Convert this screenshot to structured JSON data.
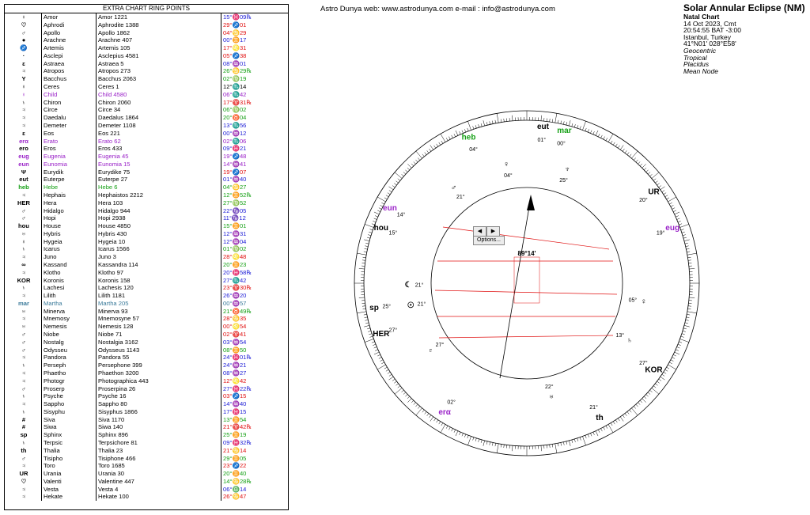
{
  "site_header": "Astro Dunya web: www.astrodunya.com e-mail : info@astrodunya.com",
  "chart_info": {
    "title": "Solar Annular Eclipse (NM)",
    "chart_type": "Natal Chart",
    "date": "14 Oct 2023, Cmt",
    "time": "20:54:55  BAT -3:00",
    "place": "Istanbul, Turkey",
    "coords": "41°N01' 028°E58'",
    "settings": [
      "Geocentric",
      "Tropical",
      "Placidus",
      "Mean Node"
    ]
  },
  "table": {
    "title": "EXTRA CHART RING POINTS",
    "rows": [
      {
        "glyph": "♀",
        "name": "Amor",
        "full": "Amor 1221",
        "pos": "15°♓09℞",
        "color": "#1c1cd6"
      },
      {
        "glyph": "♡",
        "name": "Aphrodi",
        "full": "Aphrodite 1388",
        "pos": "29°♐01",
        "color": "#e01010"
      },
      {
        "glyph": "♂",
        "name": "Apollo",
        "full": "Apollo 1862",
        "pos": "04°♋29",
        "color": "#e01010"
      },
      {
        "glyph": "●",
        "name": "Arachne",
        "full": "Arachne 407",
        "pos": "00°♊17",
        "color": "#1c1cd6"
      },
      {
        "glyph": "♐",
        "name": "Artemis",
        "full": "Artemis 105",
        "pos": "17°♌31",
        "color": "#e01010"
      },
      {
        "glyph": "·",
        "name": "Asclepi",
        "full": "Asclepius 4581",
        "pos": "05°♐38",
        "color": "#e01010"
      },
      {
        "glyph": "ɛ",
        "name": "Astraea",
        "full": "Astraea 5",
        "pos": "08°♒01",
        "color": "#1c1cd6"
      },
      {
        "glyph": "♃",
        "name": "Atropos",
        "full": "Atropos 273",
        "pos": "26°♋29℞",
        "color": "#16a016"
      },
      {
        "glyph": "Y",
        "name": "Bacchus",
        "full": "Bacchus 2063",
        "pos": "02°♍19",
        "color": "#16a016"
      },
      {
        "glyph": "♀",
        "name": "Ceres",
        "full": "Ceres 1",
        "pos": "12°♏14",
        "color": "#000000"
      },
      {
        "glyph": "♀",
        "name": "Child",
        "full": "Child 4580",
        "pos": "06°♏42",
        "color": "#9a22c8",
        "hl": true
      },
      {
        "glyph": "♄",
        "name": "Chiron",
        "full": "Chiron 2060",
        "pos": "17°♈31℞",
        "color": "#e01010"
      },
      {
        "glyph": "♃",
        "name": "Circe",
        "full": "Circe 34",
        "pos": "06°♍02",
        "color": "#16a016"
      },
      {
        "glyph": "♃",
        "name": "Daedalu",
        "full": "Daedalus 1864",
        "pos": "20°♉04",
        "color": "#16a016"
      },
      {
        "glyph": "♃",
        "name": "Demeter",
        "full": "Demeter 1108",
        "pos": "13°♏56",
        "color": "#1c1cd6"
      },
      {
        "glyph": "ɛ",
        "name": "Eos",
        "full": "Eos 221",
        "pos": "00°♒12",
        "color": "#1c1cd6"
      },
      {
        "glyph": "erα",
        "name": "Erato",
        "full": "Erato 62",
        "pos": "02°♏06",
        "color": "#9a22c8",
        "hl": true
      },
      {
        "glyph": "ero",
        "name": "Eros",
        "full": "Eros 433",
        "pos": "09°♓21",
        "color": "#1c1cd6"
      },
      {
        "glyph": "eug",
        "name": "Eugenia",
        "full": "Eugenia 45",
        "pos": "19°♐48",
        "color": "#9a22c8",
        "hl": true
      },
      {
        "glyph": "eun",
        "name": "Eunomia",
        "full": "Eunomia 15",
        "pos": "14°♒41",
        "color": "#9a22c8",
        "hl": true
      },
      {
        "glyph": "Ψ",
        "name": "Eurydik",
        "full": "Eurydike 75",
        "pos": "19°♐07",
        "color": "#e01010"
      },
      {
        "glyph": "eut",
        "name": "Euterpe",
        "full": "Euterpe 27",
        "pos": "01°♒40",
        "color": "#1c1cd6"
      },
      {
        "glyph": "heb",
        "name": "Hebe",
        "full": "Hebe 6",
        "pos": "04°♋27",
        "color": "#16a016",
        "hl": true
      },
      {
        "glyph": "♃",
        "name": "Hephais",
        "full": "Hephaistos 2212",
        "pos": "12°♊52℞",
        "color": "#16a016"
      },
      {
        "glyph": "HER",
        "name": "Hera",
        "full": "Hera 103",
        "pos": "27°♍52",
        "color": "#16a016"
      },
      {
        "glyph": "♂",
        "name": "Hidalgo",
        "full": "Hidalgo 944",
        "pos": "22°♑05",
        "color": "#1c1cd6"
      },
      {
        "glyph": "♂",
        "name": "Hopi",
        "full": "Hopi 2938",
        "pos": "11°♑12",
        "color": "#1c1cd6"
      },
      {
        "glyph": "hou",
        "name": "House",
        "full": "House 4850",
        "pos": "15°♊01",
        "color": "#16a016"
      },
      {
        "glyph": "♅",
        "name": "Hybris",
        "full": "Hybris 430",
        "pos": "12°♒31",
        "color": "#1c1cd6"
      },
      {
        "glyph": "♀",
        "name": "Hygeia",
        "full": "Hygeia 10",
        "pos": "12°♒04",
        "color": "#1c1cd6"
      },
      {
        "glyph": "♄",
        "name": "Icarus",
        "full": "Icarus 1566",
        "pos": "01°♍02",
        "color": "#16a016"
      },
      {
        "glyph": "♃",
        "name": "Juno",
        "full": "Juno 3",
        "pos": "28°♌48",
        "color": "#e01010"
      },
      {
        "glyph": "∞",
        "name": "Kassand",
        "full": "Kassandra 114",
        "pos": "20°♊23",
        "color": "#16a016"
      },
      {
        "glyph": "♃",
        "name": "Klotho",
        "full": "Klotho 97",
        "pos": "20°♓58℞",
        "color": "#1c1cd6"
      },
      {
        "glyph": "KOR",
        "name": "Koronis",
        "full": "Koronis 158",
        "pos": "27°♏42",
        "color": "#1c1cd6"
      },
      {
        "glyph": "♄",
        "name": "Lachesi",
        "full": "Lachesis 120",
        "pos": "23°♈30℞",
        "color": "#e01010"
      },
      {
        "glyph": "♃",
        "name": "Lilith",
        "full": "Lilith 1181",
        "pos": "26°♒20",
        "color": "#1c1cd6"
      },
      {
        "glyph": "mar",
        "name": "Martha",
        "full": "Martha 205",
        "pos": "00°♒57",
        "color": "#3a7a9a",
        "hl": true
      },
      {
        "glyph": "♅",
        "name": "Minerva",
        "full": "Minerva 93",
        "pos": "21°♉49℞",
        "color": "#16a016"
      },
      {
        "glyph": "♃",
        "name": "Mnemosy",
        "full": "Mnemosyne 57",
        "pos": "28°♋35",
        "color": "#e01010"
      },
      {
        "glyph": "♅",
        "name": "Nemesis",
        "full": "Nemesis 128",
        "pos": "00°♌54",
        "color": "#e01010"
      },
      {
        "glyph": "♂",
        "name": "Niobe",
        "full": "Niobe 71",
        "pos": "02°♈41",
        "color": "#e01010"
      },
      {
        "glyph": "♂",
        "name": "Nostalg",
        "full": "Nostalgia 3162",
        "pos": "03°♒54",
        "color": "#1c1cd6"
      },
      {
        "glyph": "♂",
        "name": "Odysseu",
        "full": "Odysseus 1143",
        "pos": "08°♊50",
        "color": "#16a016"
      },
      {
        "glyph": "♃",
        "name": "Pandora",
        "full": "Pandora 55",
        "pos": "24°♓01℞",
        "color": "#1c1cd6"
      },
      {
        "glyph": "♄",
        "name": "Perseph",
        "full": "Persephone 399",
        "pos": "24°♒21",
        "color": "#1c1cd6"
      },
      {
        "glyph": "♃",
        "name": "Phaetho",
        "full": "Phaethon 3200",
        "pos": "08°♒27",
        "color": "#1c1cd6"
      },
      {
        "glyph": "♃",
        "name": "Photogr",
        "full": "Photographica 443",
        "pos": "12°♌42",
        "color": "#e01010"
      },
      {
        "glyph": "♂",
        "name": "Proserp",
        "full": "Proserpina 26",
        "pos": "27°♓22℞",
        "color": "#1c1cd6"
      },
      {
        "glyph": "♄",
        "name": "Psyche",
        "full": "Psyche 16",
        "pos": "03°♐15",
        "color": "#e01010"
      },
      {
        "glyph": "♃",
        "name": "Sappho",
        "full": "Sappho 80",
        "pos": "14°♒40",
        "color": "#1c1cd6"
      },
      {
        "glyph": "♄",
        "name": "Sisyphu",
        "full": "Sisyphus 1866",
        "pos": "17°♓15",
        "color": "#1c1cd6"
      },
      {
        "glyph": "#",
        "name": "Siva",
        "full": "Siva 1170",
        "pos": "13°♊54",
        "color": "#16a016"
      },
      {
        "glyph": "#",
        "name": "Siwa",
        "full": "Siwa 140",
        "pos": "21°♈42℞",
        "color": "#e01010"
      },
      {
        "glyph": "sp",
        "name": "Sphinx",
        "full": "Sphinx 896",
        "pos": "25°♊19",
        "color": "#16a016"
      },
      {
        "glyph": "♄",
        "name": "Terpsic",
        "full": "Terpsichore 81",
        "pos": "09°♓32℞",
        "color": "#1c1cd6"
      },
      {
        "glyph": "th",
        "name": "Thalia",
        "full": "Thalia 23",
        "pos": "21°♋14",
        "color": "#e01010"
      },
      {
        "glyph": "♂",
        "name": "Tisipho",
        "full": "Tisiphone 466",
        "pos": "29°♊05",
        "color": "#16a016"
      },
      {
        "glyph": "♃",
        "name": "Toro",
        "full": "Toro 1685",
        "pos": "23°♐22",
        "color": "#e01010"
      },
      {
        "glyph": "UR",
        "name": "Urania",
        "full": "Urania 30",
        "pos": "20°♊40",
        "color": "#16a016"
      },
      {
        "glyph": "♡",
        "name": "Valenti",
        "full": "Valentine 447",
        "pos": "14°♋28℞",
        "color": "#16a016"
      },
      {
        "glyph": "♃",
        "name": "Vesta",
        "full": "Vesta 4",
        "pos": "06°♎14",
        "color": "#1c1cd6"
      },
      {
        "glyph": "♃",
        "name": "Hekate",
        "full": "Hekate 100",
        "pos": "26°♋47",
        "color": "#e01010"
      }
    ]
  },
  "wheel": {
    "center_readout": "89°14'",
    "nav": {
      "prev_label": "◀",
      "next_label": "▶",
      "options_label": "Options..."
    },
    "outer_points": [
      {
        "glyph": "eut",
        "deg": "01°",
        "color": "#000000",
        "angle": -84
      },
      {
        "glyph": "mar",
        "deg": "00°",
        "color": "#16a016",
        "angle": -76
      },
      {
        "glyph": "heb",
        "deg": "04°",
        "color": "#16a016",
        "angle": -112
      },
      {
        "glyph": "eun",
        "deg": "14°",
        "color": "#9a22c8",
        "angle": -152
      },
      {
        "glyph": "hou",
        "deg": "15°",
        "color": "#000000",
        "angle": -160
      },
      {
        "glyph": "HER",
        "deg": "27°",
        "color": "#000000",
        "angle": 160
      },
      {
        "glyph": "sp",
        "deg": "25°",
        "color": "#000000",
        "angle": 170
      },
      {
        "glyph": "erα",
        "deg": "02°",
        "color": "#9a22c8",
        "angle": 122
      },
      {
        "glyph": "KOR",
        "deg": "27°",
        "color": "#000000",
        "angle": 35
      },
      {
        "glyph": "th",
        "deg": "21°",
        "color": "#000000",
        "angle": 62
      },
      {
        "glyph": "UR",
        "deg": "20°",
        "color": "#000000",
        "angle": -35
      },
      {
        "glyph": "eug",
        "deg": "19°",
        "color": "#9a22c8",
        "angle": -20
      }
    ],
    "house_cusps": [
      {
        "label": "♀",
        "deg": "04°",
        "angle": -100
      },
      {
        "label": "♆",
        "deg": "25°",
        "angle": -70
      },
      {
        "label": "♂",
        "deg": "21°",
        "angle": -128
      },
      {
        "label": "☾",
        "deg": "21°",
        "angle": 178
      },
      {
        "label": "☉",
        "deg": "21°",
        "angle": 168
      },
      {
        "label": "♄",
        "deg": "13°",
        "angle": 30
      },
      {
        "label": "♇",
        "deg": "27°",
        "angle": 144
      },
      {
        "label": "♅",
        "deg": "22°",
        "angle": 78
      },
      {
        "label": "♀",
        "deg": "05°",
        "angle": 10
      }
    ]
  },
  "colors": {
    "red": "#e01010",
    "blue": "#1c1cd6",
    "green": "#16a016",
    "purple": "#9a22c8"
  }
}
